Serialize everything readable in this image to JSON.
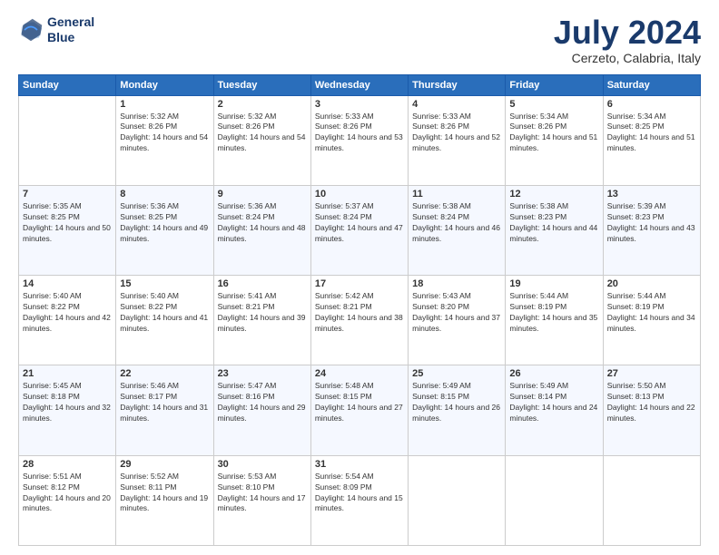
{
  "logo": {
    "line1": "General",
    "line2": "Blue"
  },
  "title": "July 2024",
  "subtitle": "Cerzeto, Calabria, Italy",
  "headers": [
    "Sunday",
    "Monday",
    "Tuesday",
    "Wednesday",
    "Thursday",
    "Friday",
    "Saturday"
  ],
  "weeks": [
    [
      {
        "day": "",
        "sunrise": "",
        "sunset": "",
        "daylight": ""
      },
      {
        "day": "1",
        "sunrise": "Sunrise: 5:32 AM",
        "sunset": "Sunset: 8:26 PM",
        "daylight": "Daylight: 14 hours and 54 minutes."
      },
      {
        "day": "2",
        "sunrise": "Sunrise: 5:32 AM",
        "sunset": "Sunset: 8:26 PM",
        "daylight": "Daylight: 14 hours and 54 minutes."
      },
      {
        "day": "3",
        "sunrise": "Sunrise: 5:33 AM",
        "sunset": "Sunset: 8:26 PM",
        "daylight": "Daylight: 14 hours and 53 minutes."
      },
      {
        "day": "4",
        "sunrise": "Sunrise: 5:33 AM",
        "sunset": "Sunset: 8:26 PM",
        "daylight": "Daylight: 14 hours and 52 minutes."
      },
      {
        "day": "5",
        "sunrise": "Sunrise: 5:34 AM",
        "sunset": "Sunset: 8:26 PM",
        "daylight": "Daylight: 14 hours and 51 minutes."
      },
      {
        "day": "6",
        "sunrise": "Sunrise: 5:34 AM",
        "sunset": "Sunset: 8:25 PM",
        "daylight": "Daylight: 14 hours and 51 minutes."
      }
    ],
    [
      {
        "day": "7",
        "sunrise": "Sunrise: 5:35 AM",
        "sunset": "Sunset: 8:25 PM",
        "daylight": "Daylight: 14 hours and 50 minutes."
      },
      {
        "day": "8",
        "sunrise": "Sunrise: 5:36 AM",
        "sunset": "Sunset: 8:25 PM",
        "daylight": "Daylight: 14 hours and 49 minutes."
      },
      {
        "day": "9",
        "sunrise": "Sunrise: 5:36 AM",
        "sunset": "Sunset: 8:24 PM",
        "daylight": "Daylight: 14 hours and 48 minutes."
      },
      {
        "day": "10",
        "sunrise": "Sunrise: 5:37 AM",
        "sunset": "Sunset: 8:24 PM",
        "daylight": "Daylight: 14 hours and 47 minutes."
      },
      {
        "day": "11",
        "sunrise": "Sunrise: 5:38 AM",
        "sunset": "Sunset: 8:24 PM",
        "daylight": "Daylight: 14 hours and 46 minutes."
      },
      {
        "day": "12",
        "sunrise": "Sunrise: 5:38 AM",
        "sunset": "Sunset: 8:23 PM",
        "daylight": "Daylight: 14 hours and 44 minutes."
      },
      {
        "day": "13",
        "sunrise": "Sunrise: 5:39 AM",
        "sunset": "Sunset: 8:23 PM",
        "daylight": "Daylight: 14 hours and 43 minutes."
      }
    ],
    [
      {
        "day": "14",
        "sunrise": "Sunrise: 5:40 AM",
        "sunset": "Sunset: 8:22 PM",
        "daylight": "Daylight: 14 hours and 42 minutes."
      },
      {
        "day": "15",
        "sunrise": "Sunrise: 5:40 AM",
        "sunset": "Sunset: 8:22 PM",
        "daylight": "Daylight: 14 hours and 41 minutes."
      },
      {
        "day": "16",
        "sunrise": "Sunrise: 5:41 AM",
        "sunset": "Sunset: 8:21 PM",
        "daylight": "Daylight: 14 hours and 39 minutes."
      },
      {
        "day": "17",
        "sunrise": "Sunrise: 5:42 AM",
        "sunset": "Sunset: 8:21 PM",
        "daylight": "Daylight: 14 hours and 38 minutes."
      },
      {
        "day": "18",
        "sunrise": "Sunrise: 5:43 AM",
        "sunset": "Sunset: 8:20 PM",
        "daylight": "Daylight: 14 hours and 37 minutes."
      },
      {
        "day": "19",
        "sunrise": "Sunrise: 5:44 AM",
        "sunset": "Sunset: 8:19 PM",
        "daylight": "Daylight: 14 hours and 35 minutes."
      },
      {
        "day": "20",
        "sunrise": "Sunrise: 5:44 AM",
        "sunset": "Sunset: 8:19 PM",
        "daylight": "Daylight: 14 hours and 34 minutes."
      }
    ],
    [
      {
        "day": "21",
        "sunrise": "Sunrise: 5:45 AM",
        "sunset": "Sunset: 8:18 PM",
        "daylight": "Daylight: 14 hours and 32 minutes."
      },
      {
        "day": "22",
        "sunrise": "Sunrise: 5:46 AM",
        "sunset": "Sunset: 8:17 PM",
        "daylight": "Daylight: 14 hours and 31 minutes."
      },
      {
        "day": "23",
        "sunrise": "Sunrise: 5:47 AM",
        "sunset": "Sunset: 8:16 PM",
        "daylight": "Daylight: 14 hours and 29 minutes."
      },
      {
        "day": "24",
        "sunrise": "Sunrise: 5:48 AM",
        "sunset": "Sunset: 8:15 PM",
        "daylight": "Daylight: 14 hours and 27 minutes."
      },
      {
        "day": "25",
        "sunrise": "Sunrise: 5:49 AM",
        "sunset": "Sunset: 8:15 PM",
        "daylight": "Daylight: 14 hours and 26 minutes."
      },
      {
        "day": "26",
        "sunrise": "Sunrise: 5:49 AM",
        "sunset": "Sunset: 8:14 PM",
        "daylight": "Daylight: 14 hours and 24 minutes."
      },
      {
        "day": "27",
        "sunrise": "Sunrise: 5:50 AM",
        "sunset": "Sunset: 8:13 PM",
        "daylight": "Daylight: 14 hours and 22 minutes."
      }
    ],
    [
      {
        "day": "28",
        "sunrise": "Sunrise: 5:51 AM",
        "sunset": "Sunset: 8:12 PM",
        "daylight": "Daylight: 14 hours and 20 minutes."
      },
      {
        "day": "29",
        "sunrise": "Sunrise: 5:52 AM",
        "sunset": "Sunset: 8:11 PM",
        "daylight": "Daylight: 14 hours and 19 minutes."
      },
      {
        "day": "30",
        "sunrise": "Sunrise: 5:53 AM",
        "sunset": "Sunset: 8:10 PM",
        "daylight": "Daylight: 14 hours and 17 minutes."
      },
      {
        "day": "31",
        "sunrise": "Sunrise: 5:54 AM",
        "sunset": "Sunset: 8:09 PM",
        "daylight": "Daylight: 14 hours and 15 minutes."
      },
      {
        "day": "",
        "sunrise": "",
        "sunset": "",
        "daylight": ""
      },
      {
        "day": "",
        "sunrise": "",
        "sunset": "",
        "daylight": ""
      },
      {
        "day": "",
        "sunrise": "",
        "sunset": "",
        "daylight": ""
      }
    ]
  ]
}
